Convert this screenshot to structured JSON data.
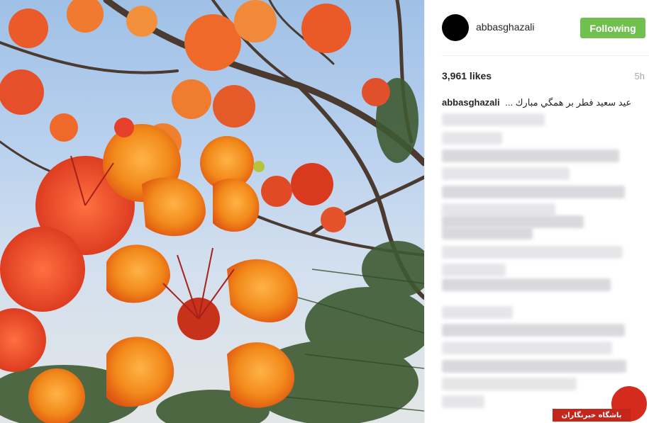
{
  "post": {
    "username": "abbasghazali",
    "follow_button_label": "Following",
    "likes": "3,961 likes",
    "time_ago": "5h",
    "caption_user": "abbasghazali",
    "caption_text": "... عيد سعيد فطر بر همگي مبارك"
  },
  "watermark": {
    "text": "باشگاه خبرنگاران"
  },
  "colors": {
    "follow_button": "#70c050",
    "watermark_red": "#d52b1e"
  }
}
